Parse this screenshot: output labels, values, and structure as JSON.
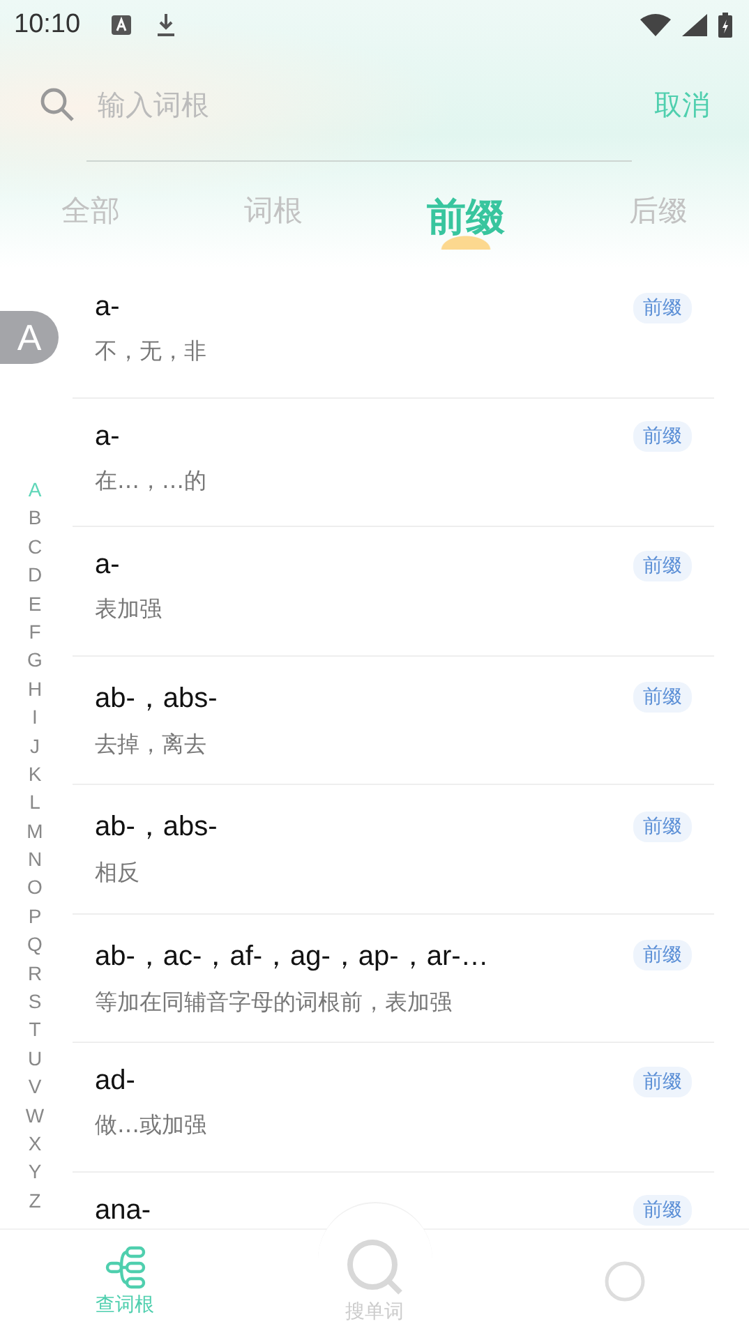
{
  "status_bar": {
    "time": "10:10"
  },
  "search": {
    "placeholder": "输入词根",
    "cancel": "取消"
  },
  "tabs": [
    {
      "label": "全部",
      "selected": false
    },
    {
      "label": "词根",
      "selected": false
    },
    {
      "label": "前缀",
      "selected": true
    },
    {
      "label": "后缀",
      "selected": false
    }
  ],
  "index_bubble": "A",
  "entries": [
    {
      "term": "a-",
      "meaning": "不，无，非",
      "tag": "前缀"
    },
    {
      "term": "a-",
      "meaning": "在…，…的",
      "tag": "前缀"
    },
    {
      "term": "a-",
      "meaning": "表加强",
      "tag": "前缀"
    },
    {
      "term": "ab-，abs-",
      "meaning": "去掉，离去",
      "tag": "前缀"
    },
    {
      "term": "ab-，abs-",
      "meaning": "相反",
      "tag": "前缀"
    },
    {
      "term": "ab-，ac-，af-，ag-，ap-，ar-…",
      "meaning": "等加在同辅音字母的词根前，表加强",
      "tag": "前缀"
    },
    {
      "term": "ad-",
      "meaning": "做…或加强",
      "tag": "前缀"
    },
    {
      "term": "ana-",
      "tag": "前缀"
    }
  ],
  "alphabet": [
    {
      "letter": "A",
      "selected": true
    },
    {
      "letter": "B",
      "selected": false
    },
    {
      "letter": "C",
      "selected": false
    },
    {
      "letter": "D",
      "selected": false
    },
    {
      "letter": "E",
      "selected": false
    },
    {
      "letter": "F",
      "selected": false
    },
    {
      "letter": "G",
      "selected": false
    },
    {
      "letter": "H",
      "selected": false
    },
    {
      "letter": "I",
      "selected": false
    },
    {
      "letter": "J",
      "selected": false
    },
    {
      "letter": "K",
      "selected": false
    },
    {
      "letter": "L",
      "selected": false
    },
    {
      "letter": "M",
      "selected": false
    },
    {
      "letter": "N",
      "selected": false
    },
    {
      "letter": "O",
      "selected": false
    },
    {
      "letter": "P",
      "selected": false
    },
    {
      "letter": "Q",
      "selected": false
    },
    {
      "letter": "R",
      "selected": false
    },
    {
      "letter": "S",
      "selected": false
    },
    {
      "letter": "T",
      "selected": false
    },
    {
      "letter": "U",
      "selected": false
    },
    {
      "letter": "V",
      "selected": false
    },
    {
      "letter": "W",
      "selected": false
    },
    {
      "letter": "X",
      "selected": false
    },
    {
      "letter": "Y",
      "selected": false
    },
    {
      "letter": "Z",
      "selected": false
    }
  ],
  "bottom_nav": [
    {
      "label": "查词根",
      "kind": "tree",
      "selected": true
    },
    {
      "label": "搜单词",
      "kind": "search",
      "selected": false
    }
  ]
}
